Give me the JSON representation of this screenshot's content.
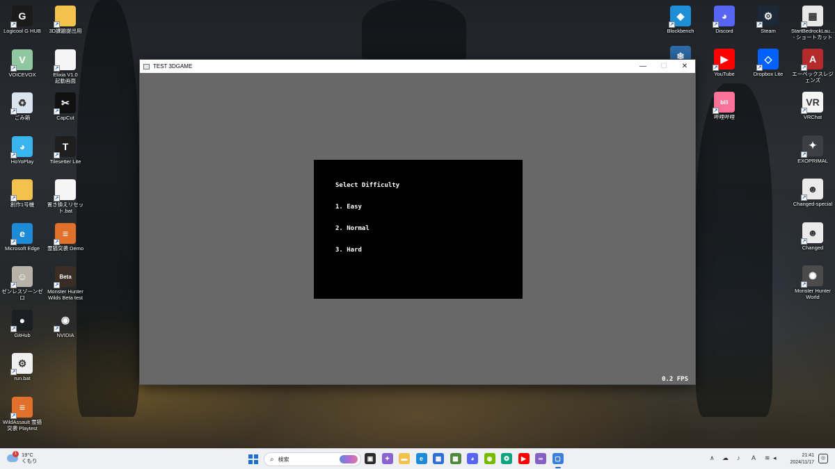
{
  "desktop": {
    "left_icons": [
      {
        "label": "Logicool G HUB",
        "icon": "logitech-g-icon",
        "glyph": "G",
        "color": "#1a1a1a"
      },
      {
        "label": "3D課題提出用",
        "icon": "folder-icon",
        "glyph": "",
        "color": "#f2c14e"
      },
      {
        "label": "VOICEVOX",
        "icon": "voicevox-icon",
        "glyph": "V",
        "color": "#8fc7a0"
      },
      {
        "label": "Elixia V1.0\n起動画面",
        "icon": "document-icon",
        "glyph": "",
        "color": "#f5f5f5"
      },
      {
        "label": "ごみ箱",
        "icon": "recycle-bin-icon",
        "glyph": "♻",
        "color": "#d9e4ef"
      },
      {
        "label": "CapCut",
        "icon": "capcut-icon",
        "glyph": "✂",
        "color": "#111111"
      },
      {
        "label": "HoYoPlay",
        "icon": "hoyoplay-icon",
        "glyph": "◕",
        "color": "#39b4ec"
      },
      {
        "label": "Tilesetter Lite",
        "icon": "tilesetter-icon",
        "glyph": "T",
        "color": "#1e1e1e"
      },
      {
        "label": "創作1号機",
        "icon": "folder-icon",
        "glyph": "",
        "color": "#f2c14e"
      },
      {
        "label": "置き換えリセット.bat",
        "icon": "batch-file-icon",
        "glyph": "",
        "color": "#f5f5f5"
      },
      {
        "label": "Microsoft Edge",
        "icon": "edge-icon",
        "glyph": "e",
        "color": "#1c8ad6"
      },
      {
        "label": "霊猫突袭 Demo",
        "icon": "wildassault-icon",
        "glyph": "≡",
        "color": "#e0702a"
      },
      {
        "label": "ゼンレスゾーンゼロ",
        "icon": "zzz-icon",
        "glyph": "☺",
        "color": "#b9b2a8"
      },
      {
        "label": "Monster Hunter\nWilds Beta test",
        "icon": "monster-hunter-beta-icon",
        "glyph": "Beta",
        "color": "#3a2e24"
      },
      {
        "label": "GitHub",
        "icon": "github-icon",
        "glyph": "●",
        "color": "#1b1f24"
      },
      {
        "label": "NVIDIA",
        "icon": "nvidia-icon",
        "glyph": "◉",
        "color": "#2a2a2a"
      },
      {
        "label": "run.bat",
        "icon": "batch-gear-icon",
        "glyph": "⚙",
        "color": "#f0f0f0"
      },
      {
        "label": "WildAssault 霊猫\n突袭 Playtest",
        "icon": "wildassault-icon",
        "glyph": "≡",
        "color": "#e0702a"
      }
    ],
    "right_icons": [
      {
        "label": "Blockbench",
        "icon": "blockbench-icon",
        "glyph": "◆",
        "color": "#1e8fd6"
      },
      {
        "label": "Discord",
        "icon": "discord-icon",
        "glyph": "◕",
        "color": "#5865f2"
      },
      {
        "label": "Steam",
        "icon": "steam-icon",
        "glyph": "⚙",
        "color": "#1b2838"
      },
      {
        "label": "StartBedrockLau...\n- ショートカット",
        "icon": "bedrock-launcher-icon",
        "glyph": "▦",
        "color": "#e8e8e8"
      },
      {
        "label": "",
        "icon": "snowflake-app-icon",
        "glyph": "❄",
        "color": "#2d6aa6"
      },
      {
        "label": "YouTube",
        "icon": "youtube-icon",
        "glyph": "▶",
        "color": "#ff0000"
      },
      {
        "label": "Dropbox Lite",
        "icon": "dropbox-icon",
        "glyph": "◇",
        "color": "#0061fe"
      },
      {
        "label": "エーペックスレジェンズ",
        "icon": "apex-legends-icon",
        "glyph": "A",
        "color": "#b52a2a"
      },
      {
        "label": "哔哩哔哩",
        "icon": "bilibili-icon",
        "glyph": "bili",
        "color": "#fb7299"
      },
      {
        "label": "VRChat",
        "icon": "vrchat-icon",
        "glyph": "VR",
        "color": "#f4f4f4"
      },
      {
        "label": "EXOPRIMAL",
        "icon": "exoprimal-icon",
        "glyph": "✦",
        "color": "#3c3f44"
      },
      {
        "label": "Changed-special",
        "icon": "changed-special-icon",
        "glyph": "☻",
        "color": "#eaeaea"
      },
      {
        "label": "Changed",
        "icon": "changed-icon",
        "glyph": "☻",
        "color": "#eaeaea"
      },
      {
        "label": "Monster Hunter\nWorld",
        "icon": "monster-hunter-world-icon",
        "glyph": "✺",
        "color": "#4b4b4b"
      }
    ]
  },
  "window": {
    "title": "TEST 3DGAME",
    "minimize_glyph": "—",
    "maximize_glyph": "☐",
    "close_glyph": "✕"
  },
  "game": {
    "menu_title": "Select Difficulty",
    "options": [
      "1. Easy",
      "2. Normal",
      "3. Hard"
    ],
    "fps": "0.2 FPS"
  },
  "taskbar": {
    "weather_temp": "19°C",
    "weather_cond": "くもり",
    "weather_badge": "1",
    "search_placeholder": "検索",
    "apps": [
      {
        "icon": "task-view-icon",
        "glyph": "▣",
        "color": "#2b2b2b"
      },
      {
        "icon": "copilot-icon",
        "glyph": "✦",
        "color": "#8a63d2"
      },
      {
        "icon": "file-explorer-icon",
        "glyph": "▬",
        "color": "#f2c14e"
      },
      {
        "icon": "edge-icon",
        "glyph": "e",
        "color": "#1c8ad6"
      },
      {
        "icon": "ms-store-icon",
        "glyph": "▦",
        "color": "#2f6fd3"
      },
      {
        "icon": "minecraft-icon",
        "glyph": "▩",
        "color": "#4f8a3c"
      },
      {
        "icon": "discord-icon",
        "glyph": "◕",
        "color": "#5865f2"
      },
      {
        "icon": "nvidia-icon",
        "glyph": "◉",
        "color": "#76b900"
      },
      {
        "icon": "chatgpt-icon",
        "glyph": "❂",
        "color": "#10a37f"
      },
      {
        "icon": "youtube-icon",
        "glyph": "▶",
        "color": "#ff0000"
      },
      {
        "icon": "visual-studio-icon",
        "glyph": "∞",
        "color": "#865fc5"
      },
      {
        "icon": "game-window-icon",
        "glyph": "▢",
        "color": "#3c7fd8"
      }
    ],
    "tray": {
      "chevron": "∧",
      "cloud": "☁",
      "mic": "♪",
      "ime": "A",
      "wifi": "≋",
      "speaker": "◂",
      "battery": "▭"
    },
    "time": "21:41",
    "date": "2024/11/17",
    "notification_glyph": "◎"
  }
}
